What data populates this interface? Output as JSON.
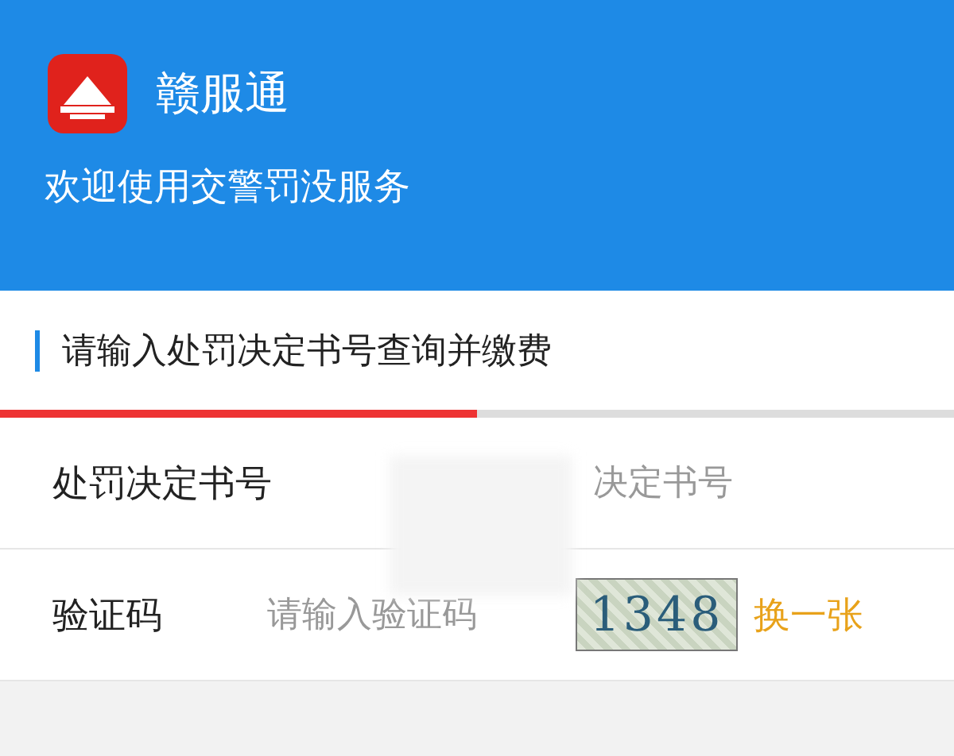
{
  "header": {
    "app_name": "赣服通",
    "subtitle": "欢迎使用交警罚没服务"
  },
  "section_title": "请输入处罚决定书号查询并缴费",
  "progress": {
    "level": 0.5
  },
  "form": [
    {
      "kind": "text",
      "label": "处罚决定书号",
      "placeholder_parts": [
        "决定书号"
      ]
    },
    {
      "kind": "captcha",
      "label": "验证码",
      "placeholder": "请输入验证码",
      "captcha_text": "1348",
      "refresh": "换一张"
    }
  ]
}
